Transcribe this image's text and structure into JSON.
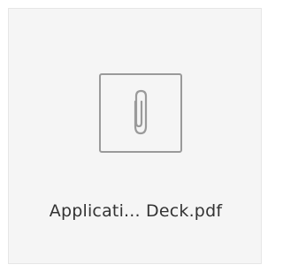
{
  "attachment": {
    "file_name": "Applicati... Deck.pdf",
    "icon": "paperclip-icon",
    "colors": {
      "tile_background": "#f5f5f5",
      "icon_stroke": "#9a9a9a",
      "text": "#333333"
    }
  }
}
